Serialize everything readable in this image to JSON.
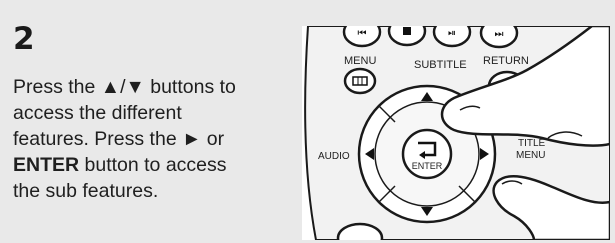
{
  "step": {
    "number": "2",
    "lines": [
      {
        "pre": "Press the ",
        "bold": "",
        "post": "▲/▼ buttons to"
      },
      {
        "pre": "access the different",
        "bold": "",
        "post": ""
      },
      {
        "pre": "features. Press the ► or",
        "bold": "",
        "post": ""
      },
      {
        "pre": "",
        "bold": "ENTER",
        "post": " button to access"
      },
      {
        "pre": "the sub features.",
        "bold": "",
        "post": ""
      }
    ]
  },
  "remote": {
    "labels": {
      "menu": "MENU",
      "subtitle": "SUBTITLE",
      "return": "RETURN",
      "audio": "AUDIO",
      "enter": "ENTER",
      "title_menu_line1": "TITLE",
      "title_menu_line2": "MENU"
    },
    "icons": [
      "skip-back-icon",
      "stop-icon",
      "play-pause-icon",
      "skip-forward-icon",
      "menu-icon",
      "enter-icon",
      "arrow-up-icon",
      "arrow-down-icon",
      "arrow-left-icon",
      "arrow-right-icon"
    ]
  }
}
